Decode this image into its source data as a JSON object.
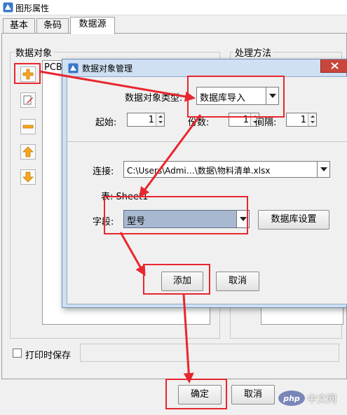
{
  "window": {
    "title": "图形属性"
  },
  "tabs": [
    {
      "label": "基本",
      "active": false
    },
    {
      "label": "条码",
      "active": false
    },
    {
      "label": "数据源",
      "active": true
    }
  ],
  "left_panel": {
    "group_label": "数据对象",
    "list_item": "PCB",
    "tools": [
      "add-icon",
      "edit-icon",
      "remove-icon",
      "move-up-icon",
      "move-down-icon"
    ]
  },
  "right_panel": {
    "group_label": "处理方法"
  },
  "print_save": {
    "label": "打印时保存",
    "checked": false
  },
  "footer": {
    "ok_label": "确定",
    "cancel_label": "取消"
  },
  "dialog": {
    "title": "数据对象管理",
    "type_label": "数据对象类型:",
    "type_value": "数据库导入",
    "start_label": "起始:",
    "start_value": "1",
    "copies_label": "份数:",
    "copies_value": "1",
    "interval_label": "间隔:",
    "interval_value": "1",
    "connection_label": "连接:",
    "connection_value": "C:\\Users\\Admi…\\数据\\物料清单.xlsx",
    "table_label": "表: Sheet1",
    "field_label": "字段:",
    "field_value": "型号",
    "db_settings_label": "数据库设置",
    "add_label": "添加",
    "cancel_label": "取消"
  },
  "watermark": {
    "text": "中文网",
    "logo": "php"
  },
  "colors": {
    "highlight": "#e8262e",
    "selection": "#a8b8d0",
    "dialog_frame": "#cfe0f3"
  }
}
